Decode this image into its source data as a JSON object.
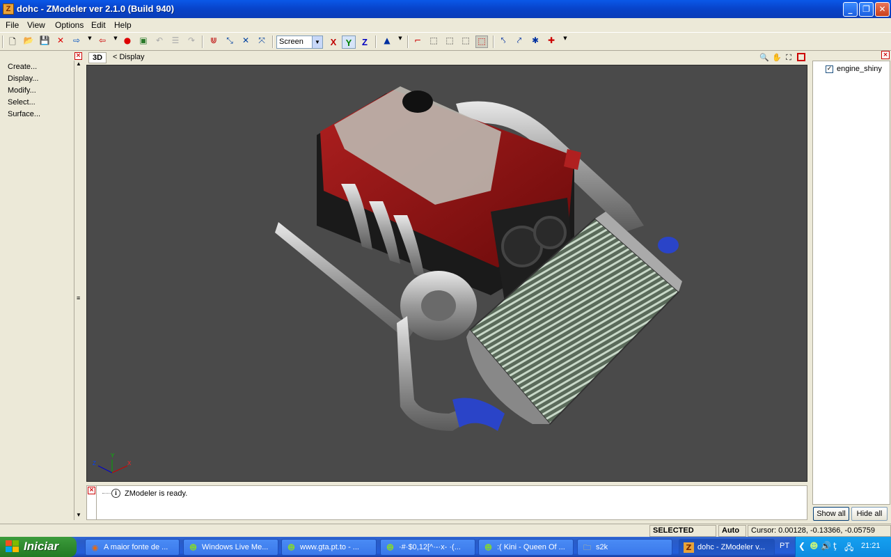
{
  "window": {
    "title": "dohc - ZModeler ver 2.1.0 (Build 940)",
    "app_icon_letter": "Z",
    "minimize": "_",
    "maximize": "❐",
    "close": "✕"
  },
  "menu": {
    "file": "File",
    "view": "View",
    "options": "Options",
    "edit": "Edit",
    "help": "Help"
  },
  "toolbar": {
    "coordinate_space": "Screen",
    "axis_x": "X",
    "axis_y": "Y",
    "axis_z": "Z",
    "colors": {
      "x": "#c00000",
      "y": "#008000",
      "z": "#0000c0"
    }
  },
  "left_panel": {
    "items": [
      "Create...",
      "Display...",
      "Modify...",
      "Select...",
      "Surface..."
    ]
  },
  "viewport": {
    "mode_tab": "3D",
    "breadcrumb": "<  Display",
    "axis_labels": {
      "z": "Z",
      "y": "Y",
      "x": "X"
    }
  },
  "log": {
    "message": "ZModeler is ready.",
    "icon": "info-icon"
  },
  "objects_panel": {
    "objects": [
      {
        "name": "engine_shiny",
        "visible": true
      }
    ],
    "show_all": "Show all",
    "hide_all": "Hide all"
  },
  "status": {
    "mode": "SELECTED MODE",
    "snap": "Auto",
    "cursor": "Cursor: 0.00128, -0.13366, -0.05759"
  },
  "taskbar": {
    "start": "Iniciar",
    "tasks": [
      {
        "label": "A maior fonte de ...",
        "icon": "firefox-icon",
        "active": false
      },
      {
        "label": "Windows Live Me...",
        "icon": "messenger-icon",
        "active": false
      },
      {
        "label": "www.gta.pt.to - ...",
        "icon": "messenger-icon",
        "active": false
      },
      {
        "label": "·#·$0,12[^·-·x- ·(...",
        "icon": "messenger-icon",
        "active": false
      },
      {
        "label": ":( Kini - Queen Of ...",
        "icon": "messenger-icon",
        "active": false
      },
      {
        "label": "s2k",
        "icon": "folder-icon",
        "active": false
      },
      {
        "label": "dohc - ZModeler v...",
        "icon": "zmodeler-icon",
        "active": true
      }
    ],
    "language": "PT",
    "clock": "21:21"
  }
}
